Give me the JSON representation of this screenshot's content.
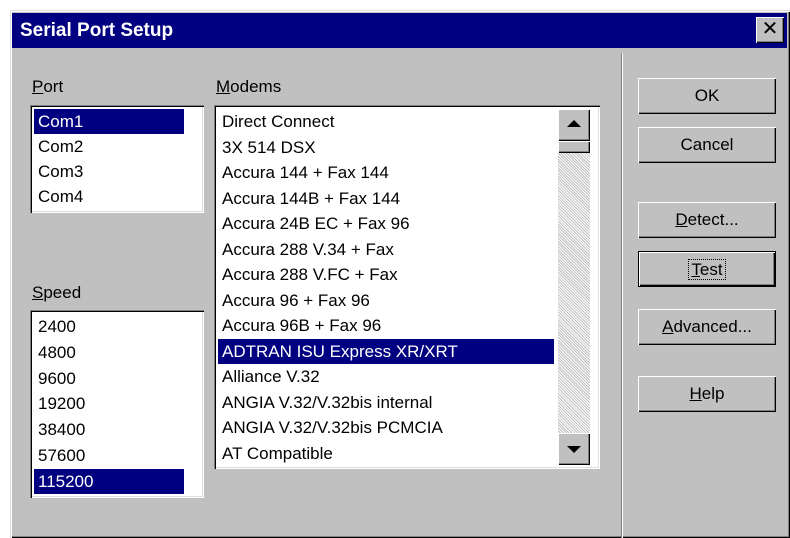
{
  "window": {
    "title": "Serial Port Setup",
    "close_glyph": "✕"
  },
  "port": {
    "label_mnemonic": "P",
    "label_rest": "ort",
    "items": [
      "Com1",
      "Com2",
      "Com3",
      "Com4"
    ],
    "selected": "Com1"
  },
  "modems": {
    "label_mnemonic": "M",
    "label_rest": "odems",
    "items": [
      "Direct Connect",
      "3X 514 DSX",
      "Accura 144 + Fax 144",
      "Accura 144B + Fax 144",
      "Accura 24B EC + Fax 96",
      "Accura 288 V.34 + Fax",
      "Accura 288 V.FC + Fax",
      "Accura 96 + Fax 96",
      "Accura 96B + Fax 96",
      "ADTRAN ISU Express XR/XRT",
      "Alliance V.32",
      "ANGIA V.32/V.32bis internal",
      "ANGIA V.32/V.32bis PCMCIA",
      "AT Compatible"
    ],
    "selected": "ADTRAN ISU Express XR/XRT"
  },
  "speed": {
    "label_mnemonic": "S",
    "label_rest": "peed",
    "items": [
      "2400",
      "4800",
      "9600",
      "19200",
      "38400",
      "57600",
      "115200"
    ],
    "selected": "115200"
  },
  "buttons": {
    "ok": {
      "label": "OK"
    },
    "cancel": {
      "label": "Cancel"
    },
    "detect": {
      "mnemonic": "D",
      "rest": "etect..."
    },
    "test": {
      "mnemonic": "T",
      "rest": "est"
    },
    "advanced": {
      "mnemonic": "A",
      "rest": "dvanced..."
    },
    "help": {
      "mnemonic": "H",
      "rest": "elp"
    }
  },
  "colors": {
    "face": "#c0c0c0",
    "title_bar": "#000080",
    "selection": "#000080"
  }
}
